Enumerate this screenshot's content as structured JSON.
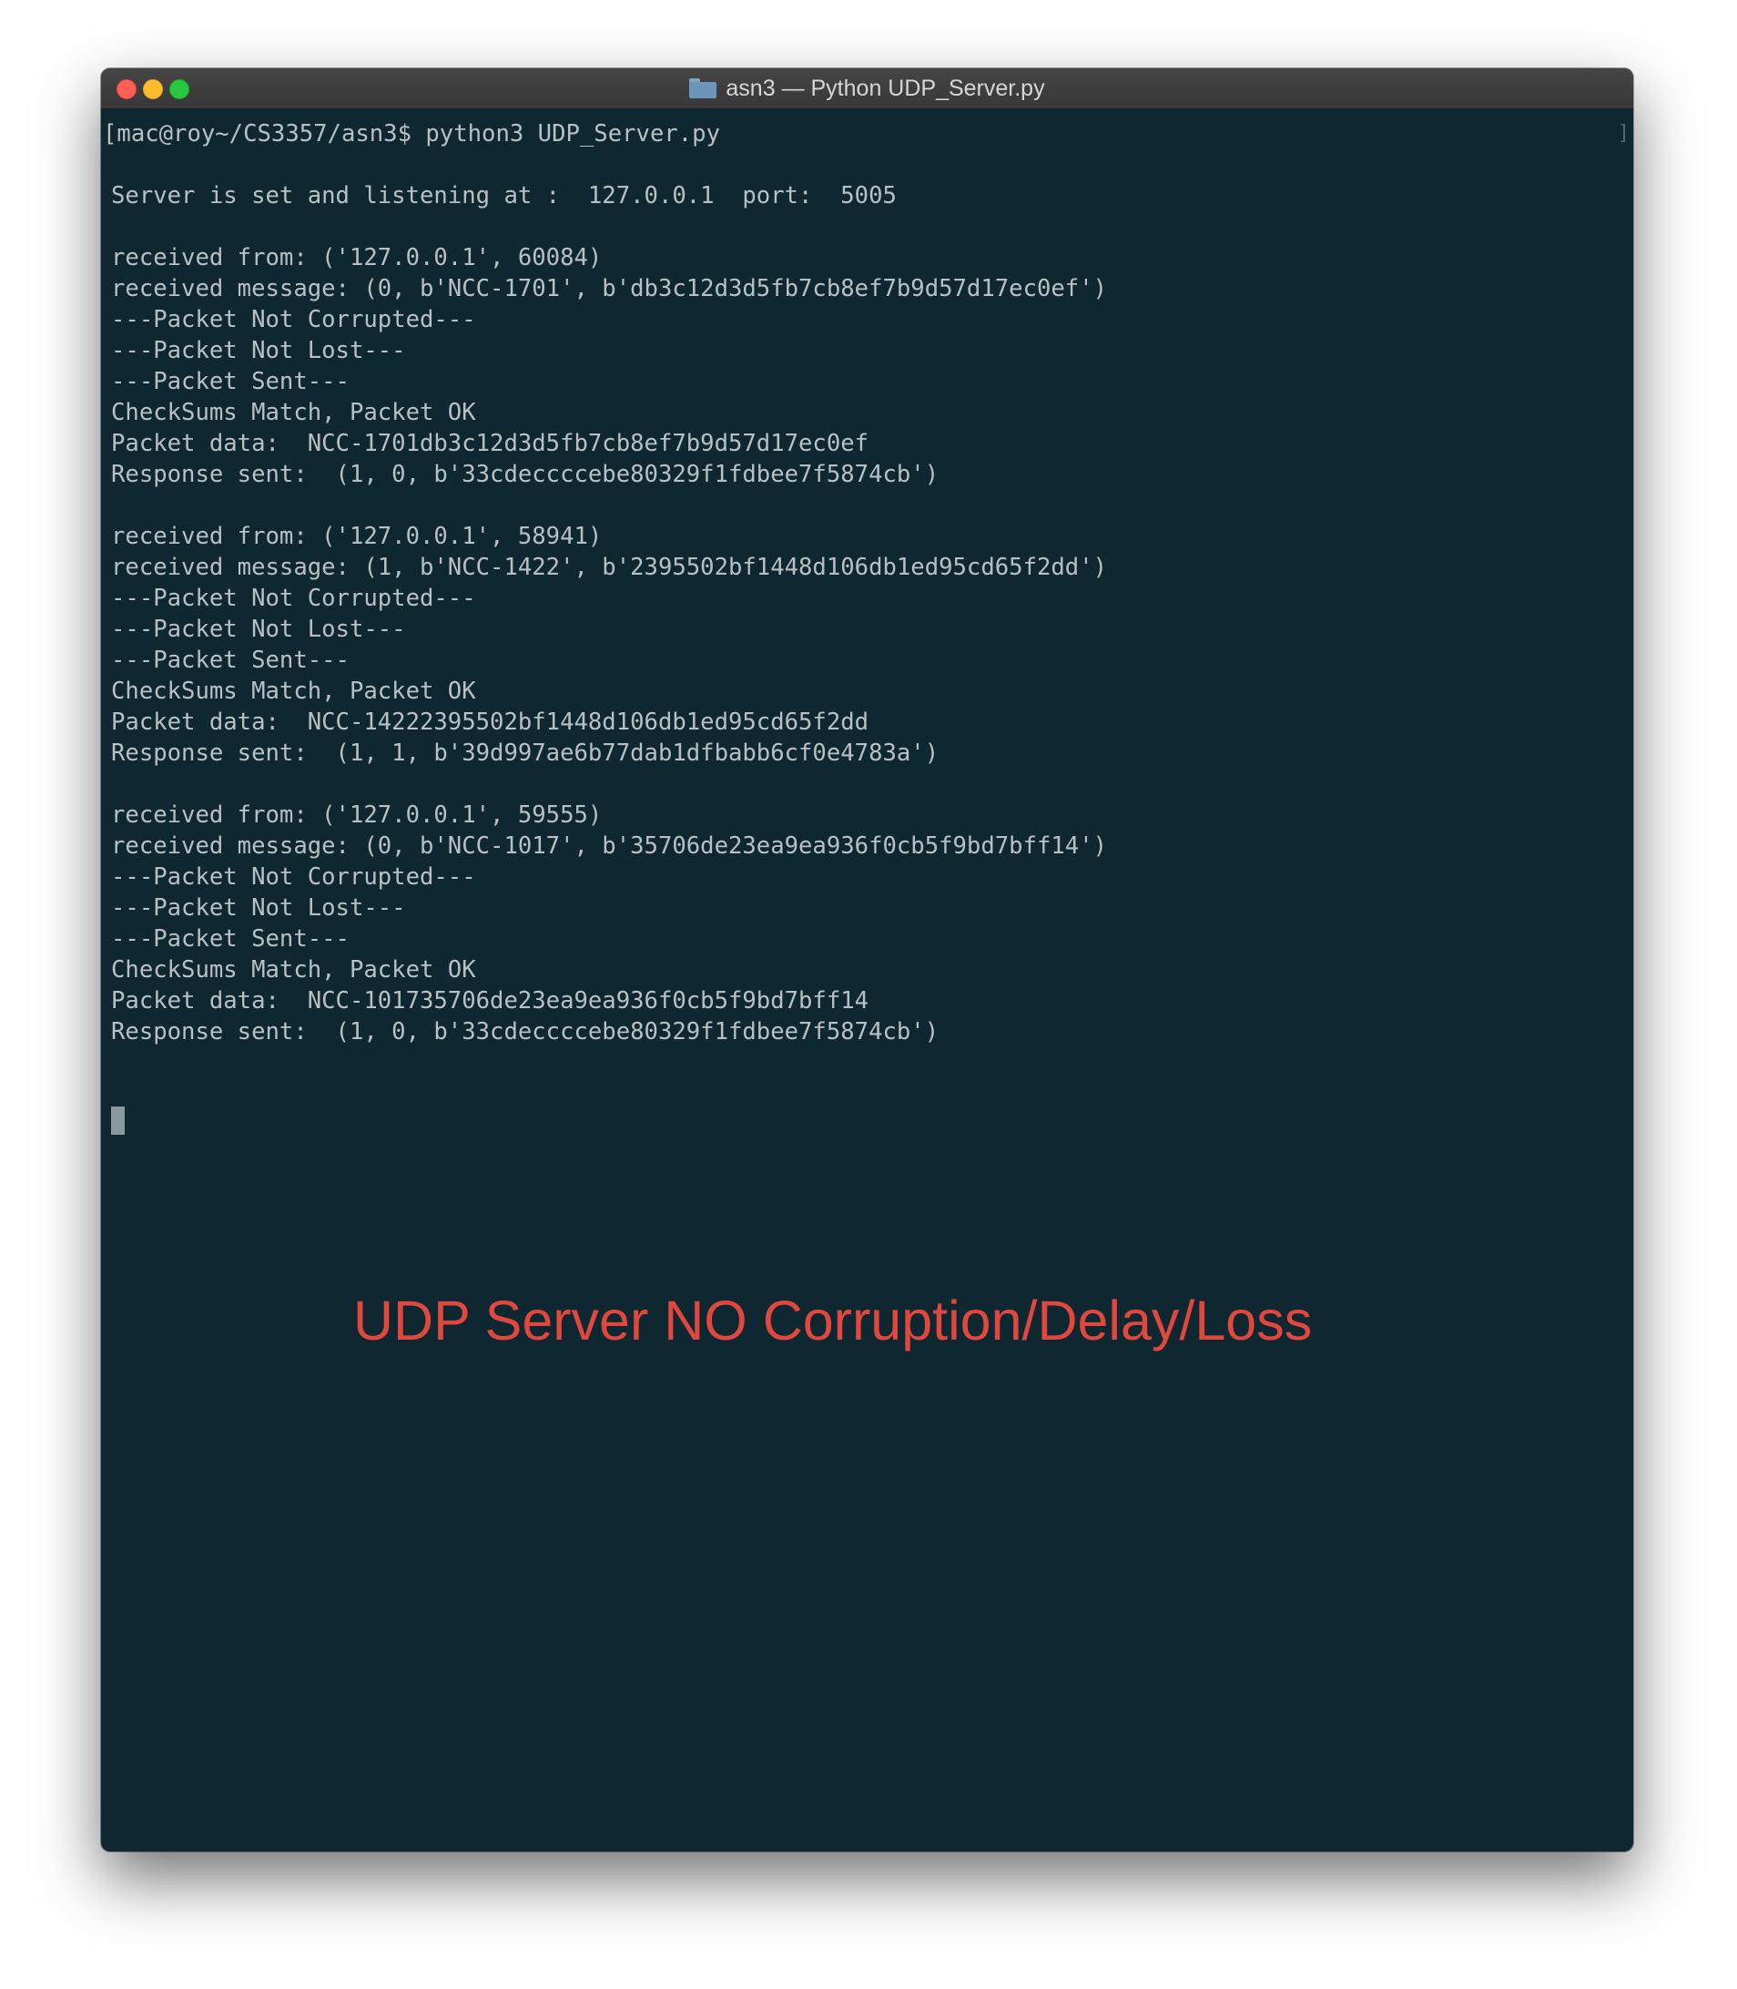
{
  "window": {
    "title": "asn3 — Python UDP_Server.py",
    "title_icon": "folder-icon",
    "colors": {
      "terminal_background": "#0f2731",
      "terminal_text": "#b9c0c3",
      "caption": "#e0483d",
      "close": "#fd5f57",
      "minimize": "#febc2e",
      "zoom": "#28c840"
    }
  },
  "terminal": {
    "prompt_line": "[mac@roy~/CS3357/asn3$ python3 UDP_Server.py",
    "scroll_marker": "]",
    "lines": [
      "",
      "Server is set and listening at :  127.0.0.1  port:  5005",
      "",
      "received from: ('127.0.0.1', 60084)",
      "received message: (0, b'NCC-1701', b'db3c12d3d5fb7cb8ef7b9d57d17ec0ef')",
      "---Packet Not Corrupted---",
      "---Packet Not Lost---",
      "---Packet Sent---",
      "CheckSums Match, Packet OK",
      "Packet data:  NCC-1701db3c12d3d5fb7cb8ef7b9d57d17ec0ef",
      "Response sent:  (1, 0, b'33cdeccccebe80329f1fdbee7f5874cb')",
      "",
      "received from: ('127.0.0.1', 58941)",
      "received message: (1, b'NCC-1422', b'2395502bf1448d106db1ed95cd65f2dd')",
      "---Packet Not Corrupted---",
      "---Packet Not Lost---",
      "---Packet Sent---",
      "CheckSums Match, Packet OK",
      "Packet data:  NCC-14222395502bf1448d106db1ed95cd65f2dd",
      "Response sent:  (1, 1, b'39d997ae6b77dab1dfbabb6cf0e4783a')",
      "",
      "received from: ('127.0.0.1', 59555)",
      "received message: (0, b'NCC-1017', b'35706de23ea9ea936f0cb5f9bd7bff14')",
      "---Packet Not Corrupted---",
      "---Packet Not Lost---",
      "---Packet Sent---",
      "CheckSums Match, Packet OK",
      "Packet data:  NCC-101735706de23ea9ea936f0cb5f9bd7bff14",
      "Response sent:  (1, 0, b'33cdeccccebe80329f1fdbee7f5874cb')"
    ]
  },
  "caption": {
    "text": "UDP Server NO Corruption/Delay/Loss"
  }
}
